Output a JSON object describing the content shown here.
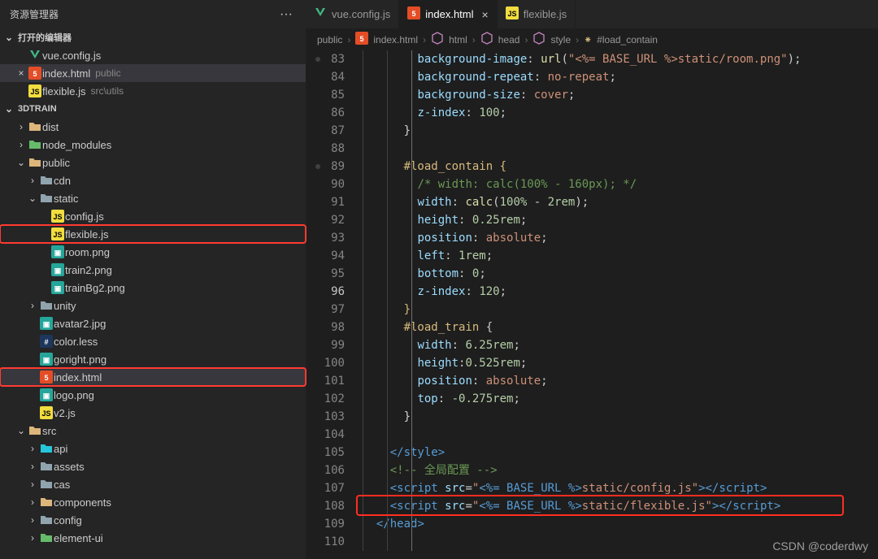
{
  "sidebar": {
    "title": "资源管理器",
    "openEditorsLabel": "打开的编辑器",
    "openEditors": [
      {
        "icon": "vue",
        "label": "vue.config.js",
        "meta": "",
        "close": false
      },
      {
        "icon": "html",
        "label": "index.html",
        "meta": "public",
        "close": true,
        "active": true
      },
      {
        "icon": "js",
        "label": "flexible.js",
        "meta": "src\\utils",
        "close": false
      }
    ],
    "project": "3DTRAIN",
    "tree": [
      {
        "d": 1,
        "chev": ">",
        "icon": "folder-y",
        "label": "dist"
      },
      {
        "d": 1,
        "chev": ">",
        "icon": "folder-g",
        "label": "node_modules"
      },
      {
        "d": 1,
        "chev": "v",
        "icon": "folder-o",
        "label": "public"
      },
      {
        "d": 2,
        "chev": ">",
        "icon": "folder",
        "label": "cdn"
      },
      {
        "d": 2,
        "chev": "v",
        "icon": "folder",
        "label": "static"
      },
      {
        "d": 3,
        "chev": "",
        "icon": "js",
        "label": "config.js"
      },
      {
        "d": 3,
        "chev": "",
        "icon": "js",
        "label": "flexible.js",
        "hl": true
      },
      {
        "d": 3,
        "chev": "",
        "icon": "img",
        "label": "room.png"
      },
      {
        "d": 3,
        "chev": "",
        "icon": "img",
        "label": "train2.png"
      },
      {
        "d": 3,
        "chev": "",
        "icon": "img",
        "label": "trainBg2.png"
      },
      {
        "d": 2,
        "chev": ">",
        "icon": "folder",
        "label": "unity"
      },
      {
        "d": 2,
        "chev": "",
        "icon": "img",
        "label": "avatar2.jpg"
      },
      {
        "d": 2,
        "chev": "",
        "icon": "less",
        "label": "color.less"
      },
      {
        "d": 2,
        "chev": "",
        "icon": "img",
        "label": "goright.png"
      },
      {
        "d": 2,
        "chev": "",
        "icon": "html",
        "label": "index.html",
        "active": true,
        "hl": true
      },
      {
        "d": 2,
        "chev": "",
        "icon": "img",
        "label": "logo.png"
      },
      {
        "d": 2,
        "chev": "",
        "icon": "js",
        "label": "v2.js"
      },
      {
        "d": 1,
        "chev": "v",
        "icon": "folder-o",
        "label": "src"
      },
      {
        "d": 2,
        "chev": ">",
        "icon": "folder-p",
        "label": "api"
      },
      {
        "d": 2,
        "chev": ">",
        "icon": "folder",
        "label": "assets"
      },
      {
        "d": 2,
        "chev": ">",
        "icon": "folder",
        "label": "cas"
      },
      {
        "d": 2,
        "chev": ">",
        "icon": "folder-y",
        "label": "components"
      },
      {
        "d": 2,
        "chev": ">",
        "icon": "folder",
        "label": "config"
      },
      {
        "d": 2,
        "chev": ">",
        "icon": "folder-g",
        "label": "element-ui"
      }
    ]
  },
  "tabs": [
    {
      "icon": "vue",
      "label": "vue.config.js"
    },
    {
      "icon": "html",
      "label": "index.html",
      "active": true,
      "close": true
    },
    {
      "icon": "js",
      "label": "flexible.js"
    }
  ],
  "breadcrumbs": [
    "public",
    "index.html",
    "html",
    "head",
    "style",
    "#load_contain"
  ],
  "breadcrumbIcons": [
    "",
    "html",
    "cube",
    "cube",
    "cube",
    "hash"
  ],
  "startLine": 83,
  "currentLine": 96,
  "highlightLine": 108,
  "code": [
    [
      [
        "        ",
        ""
      ],
      [
        "background-image",
        "c-prop"
      ],
      [
        ": ",
        ""
      ],
      [
        "url",
        "c-func"
      ],
      [
        "(",
        ""
      ],
      [
        "\"<%= BASE_URL %>static/room.png\"",
        "c-str"
      ],
      [
        ")",
        ""
      ],
      [
        ";",
        ""
      ]
    ],
    [
      [
        "        ",
        ""
      ],
      [
        "background-repeat",
        "c-prop"
      ],
      [
        ": ",
        ""
      ],
      [
        "no-repeat",
        "c-kw"
      ],
      [
        ";",
        ""
      ]
    ],
    [
      [
        "        ",
        ""
      ],
      [
        "background-size",
        "c-prop"
      ],
      [
        ": ",
        ""
      ],
      [
        "cover",
        "c-kw"
      ],
      [
        ";",
        ""
      ]
    ],
    [
      [
        "        ",
        ""
      ],
      [
        "z-index",
        "c-prop"
      ],
      [
        ": ",
        ""
      ],
      [
        "100",
        "c-num"
      ],
      [
        ";",
        ""
      ]
    ],
    [
      [
        "      ",
        ""
      ],
      [
        "}",
        "c-br"
      ]
    ],
    [
      [
        "",
        ""
      ]
    ],
    [
      [
        "      ",
        ""
      ],
      [
        "#load_contain",
        "c-sel"
      ],
      [
        " ",
        ""
      ],
      [
        "{",
        "c-sel"
      ]
    ],
    [
      [
        "        ",
        ""
      ],
      [
        "/* width: calc(100% - 160px); */",
        "c-cmt"
      ]
    ],
    [
      [
        "        ",
        ""
      ],
      [
        "width",
        "c-prop"
      ],
      [
        ": ",
        ""
      ],
      [
        "calc",
        "c-func"
      ],
      [
        "(",
        ""
      ],
      [
        "100%",
        "c-num"
      ],
      [
        " - ",
        ""
      ],
      [
        "2rem",
        "c-num"
      ],
      [
        ")",
        ""
      ],
      [
        ";",
        ""
      ]
    ],
    [
      [
        "        ",
        ""
      ],
      [
        "height",
        "c-prop"
      ],
      [
        ": ",
        ""
      ],
      [
        "0.25rem",
        "c-num"
      ],
      [
        ";",
        ""
      ]
    ],
    [
      [
        "        ",
        ""
      ],
      [
        "position",
        "c-prop"
      ],
      [
        ": ",
        ""
      ],
      [
        "absolute",
        "c-kw"
      ],
      [
        ";",
        ""
      ]
    ],
    [
      [
        "        ",
        ""
      ],
      [
        "left",
        "c-prop"
      ],
      [
        ": ",
        ""
      ],
      [
        "1rem",
        "c-num"
      ],
      [
        ";",
        ""
      ]
    ],
    [
      [
        "        ",
        ""
      ],
      [
        "bottom",
        "c-prop"
      ],
      [
        ": ",
        ""
      ],
      [
        "0",
        "c-num"
      ],
      [
        ";",
        ""
      ]
    ],
    [
      [
        "        ",
        ""
      ],
      [
        "z-index",
        "c-prop"
      ],
      [
        ": ",
        ""
      ],
      [
        "120",
        "c-num"
      ],
      [
        ";",
        ""
      ]
    ],
    [
      [
        "      ",
        ""
      ],
      [
        "}",
        "c-sel"
      ]
    ],
    [
      [
        "      ",
        ""
      ],
      [
        "#load_train",
        "c-sel"
      ],
      [
        " {",
        ""
      ]
    ],
    [
      [
        "        ",
        ""
      ],
      [
        "width",
        "c-prop"
      ],
      [
        ": ",
        ""
      ],
      [
        "6.25rem",
        "c-num"
      ],
      [
        ";",
        ""
      ]
    ],
    [
      [
        "        ",
        ""
      ],
      [
        "height",
        "c-prop"
      ],
      [
        ":",
        ""
      ],
      [
        "0.525rem",
        "c-num"
      ],
      [
        ";",
        ""
      ]
    ],
    [
      [
        "        ",
        ""
      ],
      [
        "position",
        "c-prop"
      ],
      [
        ": ",
        ""
      ],
      [
        "absolute",
        "c-kw"
      ],
      [
        ";",
        ""
      ]
    ],
    [
      [
        "        ",
        ""
      ],
      [
        "top",
        "c-prop"
      ],
      [
        ": ",
        ""
      ],
      [
        "-0.275rem",
        "c-num"
      ],
      [
        ";",
        ""
      ]
    ],
    [
      [
        "      ",
        ""
      ],
      [
        "}",
        "c-br"
      ]
    ],
    [
      [
        "",
        ""
      ]
    ],
    [
      [
        "    ",
        ""
      ],
      [
        "</",
        "c-tag"
      ],
      [
        "style",
        "c-tag"
      ],
      [
        ">",
        "c-tag"
      ]
    ],
    [
      [
        "    ",
        ""
      ],
      [
        "<!-- 全局配置 -->",
        "c-cmt"
      ]
    ],
    [
      [
        "    ",
        ""
      ],
      [
        "<",
        "c-tag"
      ],
      [
        "script",
        "c-tag"
      ],
      [
        " ",
        ""
      ],
      [
        "src",
        "c-attr"
      ],
      [
        "=",
        ""
      ],
      [
        "\"",
        "c-str"
      ],
      [
        "<%= BASE_URL %>",
        "c-tag"
      ],
      [
        "static/config.js\"",
        "c-str"
      ],
      [
        "></",
        "c-tag"
      ],
      [
        "script",
        "c-tag"
      ],
      [
        ">",
        "c-tag"
      ]
    ],
    [
      [
        "    ",
        ""
      ],
      [
        "<",
        "c-tag"
      ],
      [
        "script",
        "c-tag"
      ],
      [
        " ",
        ""
      ],
      [
        "src",
        "c-attr"
      ],
      [
        "=",
        ""
      ],
      [
        "\"",
        "c-str"
      ],
      [
        "<%= BASE_URL %>",
        "c-tag"
      ],
      [
        "static/flexible.js\"",
        "c-str"
      ],
      [
        "></",
        "c-tag"
      ],
      [
        "script",
        "c-tag"
      ],
      [
        ">",
        "c-tag"
      ]
    ],
    [
      [
        "  ",
        ""
      ],
      [
        "</",
        "c-tag"
      ],
      [
        "head",
        "c-tag"
      ],
      [
        ">",
        "c-tag"
      ]
    ],
    [
      [
        "",
        ""
      ]
    ]
  ],
  "watermark": "CSDN @coderdwy"
}
